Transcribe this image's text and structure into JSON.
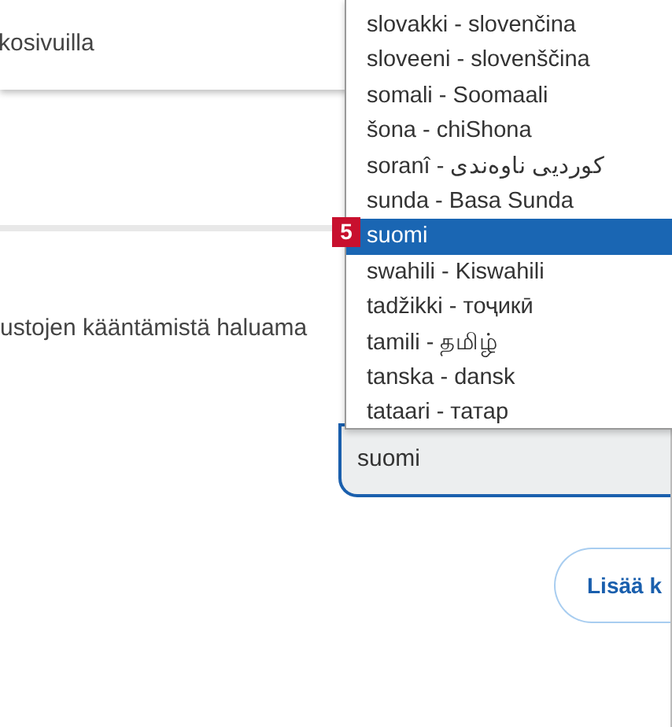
{
  "top_card": {
    "text": "kosivuilla"
  },
  "section": {
    "text": "ustojen kääntämistä haluama"
  },
  "dropdown": {
    "options": [
      {
        "label": "slovakki - slovenčina",
        "selected": false
      },
      {
        "label": "sloveeni - slovenščina",
        "selected": false
      },
      {
        "label": "somali - Soomaali",
        "selected": false
      },
      {
        "label": "šona - chiShona",
        "selected": false
      },
      {
        "label": "soranî - کوردیی ناوەندی",
        "selected": false
      },
      {
        "label": "sunda - Basa Sunda",
        "selected": false
      },
      {
        "label": "suomi",
        "selected": true
      },
      {
        "label": "swahili - Kiswahili",
        "selected": false
      },
      {
        "label": "tadžikki - тоҷикӣ",
        "selected": false
      },
      {
        "label": "tamili - தமிழ்",
        "selected": false
      },
      {
        "label": "tanska - dansk",
        "selected": false
      },
      {
        "label": "tataari - татар",
        "selected": false
      }
    ]
  },
  "step_badge": "5",
  "language_select": {
    "value": "suomi"
  },
  "button": {
    "label": "Lisää k"
  }
}
